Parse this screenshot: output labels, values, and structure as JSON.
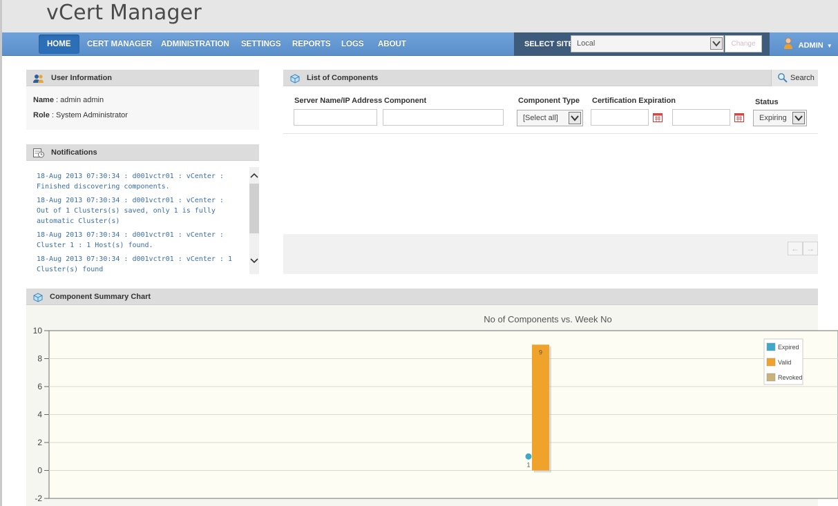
{
  "app": {
    "title": "vCert Manager"
  },
  "nav": {
    "items": [
      "HOME",
      "CERT MANAGER",
      "ADMINISTRATION",
      "SETTINGS",
      "REPORTS",
      "LOGS",
      "ABOUT"
    ],
    "active": "HOME",
    "site_label": "SELECT SITE",
    "site_value": "Local",
    "change_label": "Change",
    "user_label": "ADMIN"
  },
  "user_info": {
    "title": "User Information",
    "name_label": "Name",
    "name_value": " : admin admin",
    "role_label": "Role",
    "role_value": " : System Administrator"
  },
  "notifications": {
    "title": "Notifications",
    "items": [
      [
        "18-Aug 2013 07:30:34 : d001vctr01 : vCenter :",
        "Finished discovering components."
      ],
      [
        "18-Aug 2013 07:30:34 : d001vctr01 : vCenter :",
        "Out of 1 Clusters(s) saved, only 1 is fully",
        "automatic Cluster(s)"
      ],
      [
        "18-Aug 2013 07:30:34 : d001vctr01 : vCenter :",
        "Cluster 1 : 1 Host(s) found."
      ],
      [
        "18-Aug 2013 07:30:34 : d001vctr01 : vCenter : 1",
        "Cluster(s) found"
      ]
    ]
  },
  "components": {
    "title": "List of Components",
    "search_label": "Search",
    "columns": {
      "server": "Server Name/IP Address",
      "component": "Component",
      "type": "Component Type",
      "expiration": "Certification Expiration",
      "status": "Status"
    },
    "type_value": "[Select all]",
    "status_value": "Expiring",
    "pager_prev": "←",
    "pager_next": "→"
  },
  "summary": {
    "title": "Component Summary Chart"
  },
  "colors": {
    "nav_bg": "#5b8fca",
    "nav_active": "#2d6fb7",
    "expired": "#3fa9c9",
    "valid": "#f0a32a",
    "revoked": "#c8b27a",
    "link": "#3a6ea8"
  },
  "chart_data": {
    "type": "bar",
    "title": "No of Components vs. Week No",
    "ylim": [
      -2,
      10
    ],
    "y_ticks": [
      -2,
      0,
      2,
      4,
      6,
      8,
      10
    ],
    "grid": true,
    "legend_position": "top-right",
    "series": [
      {
        "name": "Expired",
        "color": "#3fa9c9",
        "values": [
          1
        ]
      },
      {
        "name": "Valid",
        "color": "#f0a32a",
        "values": [
          9
        ]
      },
      {
        "name": "Revoked",
        "color": "#c8b27a",
        "values": [
          0
        ]
      }
    ]
  }
}
